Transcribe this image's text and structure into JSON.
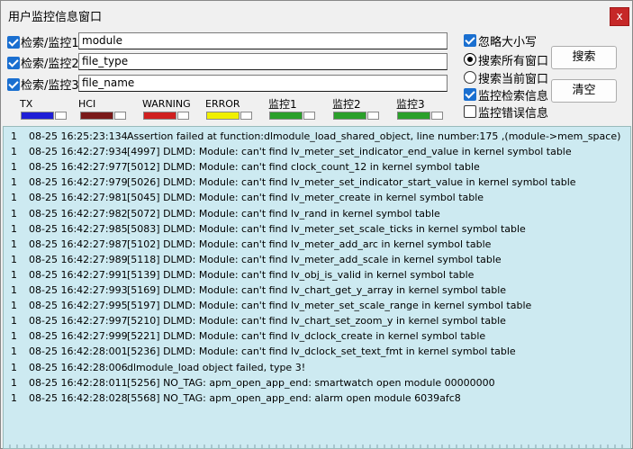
{
  "window": {
    "title": "用户监控信息窗口",
    "close_label": "x"
  },
  "filters": [
    {
      "label": "检索/监控1",
      "value": "module",
      "checked": true
    },
    {
      "label": "检索/监控2",
      "value": "file_type",
      "checked": true
    },
    {
      "label": "检索/监控3",
      "value": "file_name",
      "checked": true
    }
  ],
  "options": {
    "ignore_case": {
      "label": "忽略大小写",
      "checked": true
    },
    "search_all": {
      "label": "搜索所有窗口",
      "selected": true
    },
    "search_current": {
      "label": "搜索当前窗口",
      "selected": false
    },
    "monitor_search": {
      "label": "监控检索信息",
      "checked": true
    },
    "monitor_error": {
      "label": "监控错误信息",
      "checked": false
    }
  },
  "buttons": {
    "search": "搜索",
    "clear": "清空"
  },
  "legend": [
    {
      "label": "TX",
      "color": "#1f1fd6"
    },
    {
      "label": "HCI",
      "color": "#7a1a1a"
    },
    {
      "label": "WARNING",
      "color": "#d02020"
    },
    {
      "label": "ERROR",
      "color": "#f0f000"
    },
    {
      "label": "监控1",
      "color": "#2aa02a"
    },
    {
      "label": "监控2",
      "color": "#2aa02a"
    },
    {
      "label": "监控3",
      "color": "#2aa02a"
    }
  ],
  "log": [
    {
      "level": "1",
      "time": "08-25 16:25:23:134",
      "msg": "Assertion failed at function:dlmodule_load_shared_object, line number:175 ,(module->mem_space)"
    },
    {
      "level": "1",
      "time": "08-25 16:42:27:934",
      "msg": "[4997] DLMD: Module: can't find lv_meter_set_indicator_end_value in kernel symbol table"
    },
    {
      "level": "1",
      "time": "08-25 16:42:27:977",
      "msg": "[5012] DLMD: Module: can't find clock_count_12 in kernel symbol table"
    },
    {
      "level": "1",
      "time": "08-25 16:42:27:979",
      "msg": "[5026] DLMD: Module: can't find lv_meter_set_indicator_start_value in kernel symbol table"
    },
    {
      "level": "1",
      "time": "08-25 16:42:27:981",
      "msg": "[5045] DLMD: Module: can't find lv_meter_create in kernel symbol table"
    },
    {
      "level": "1",
      "time": "08-25 16:42:27:982",
      "msg": "[5072] DLMD: Module: can't find lv_rand in kernel symbol table"
    },
    {
      "level": "1",
      "time": "08-25 16:42:27:985",
      "msg": "[5083] DLMD: Module: can't find lv_meter_set_scale_ticks in kernel symbol table"
    },
    {
      "level": "1",
      "time": "08-25 16:42:27:987",
      "msg": "[5102] DLMD: Module: can't find lv_meter_add_arc in kernel symbol table"
    },
    {
      "level": "1",
      "time": "08-25 16:42:27:989",
      "msg": "[5118] DLMD: Module: can't find lv_meter_add_scale in kernel symbol table"
    },
    {
      "level": "1",
      "time": "08-25 16:42:27:991",
      "msg": "[5139] DLMD: Module: can't find lv_obj_is_valid in kernel symbol table"
    },
    {
      "level": "1",
      "time": "08-25 16:42:27:993",
      "msg": "[5169] DLMD: Module: can't find lv_chart_get_y_array in kernel symbol table"
    },
    {
      "level": "1",
      "time": "08-25 16:42:27:995",
      "msg": "[5197] DLMD: Module: can't find lv_meter_set_scale_range in kernel symbol table"
    },
    {
      "level": "1",
      "time": "08-25 16:42:27:997",
      "msg": "[5210] DLMD: Module: can't find lv_chart_set_zoom_y in kernel symbol table"
    },
    {
      "level": "1",
      "time": "08-25 16:42:27:999",
      "msg": "[5221] DLMD: Module: can't find lv_dclock_create in kernel symbol table"
    },
    {
      "level": "1",
      "time": "08-25 16:42:28:001",
      "msg": "[5236] DLMD: Module: can't find lv_dclock_set_text_fmt in kernel symbol table"
    },
    {
      "level": "1",
      "time": "08-25 16:42:28:006",
      "msg": "dlmodule_load object failed, type 3!"
    },
    {
      "level": "1",
      "time": "08-25 16:42:28:011",
      "msg": "[5256] NO_TAG: apm_open_app_end: smartwatch open module 00000000"
    },
    {
      "level": "1",
      "time": "08-25 16:42:28:028",
      "msg": "[5568] NO_TAG: apm_open_app_end: alarm open module 6039afc8"
    }
  ]
}
